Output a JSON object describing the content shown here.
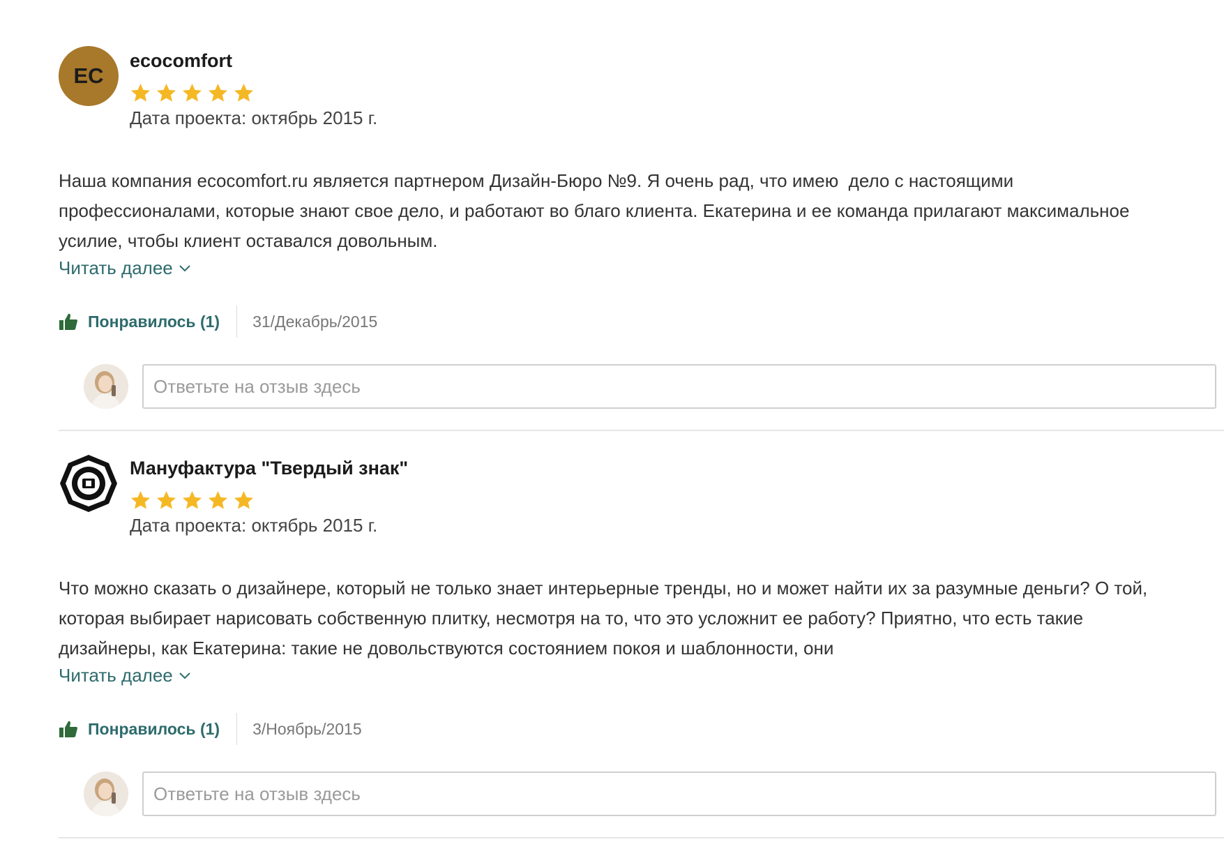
{
  "reviews": [
    {
      "reviewer_name": "ecocomfort",
      "avatar_initials": "EC",
      "rating": 5,
      "project_date": "Дата проекта: октябрь 2015 г.",
      "text": "Наша компания ecocomfort.ru является партнером Дизайн-Бюро №9. Я очень рад, что имею  дело с настоящими профессионалами, которые знают свое дело, и работают во благо клиента. Екатерина и ее команда прилагают максимальное усилие, чтобы клиент оставался довольным.",
      "read_more": "Читать далее",
      "like_label": "Понравилось (1)",
      "date": "31/Декабрь/2015",
      "reply_placeholder": "Ответьте на отзыв здесь"
    },
    {
      "reviewer_name": "Мануфактура \"Твердый знак\"",
      "avatar_logo": "manufaktura-logo",
      "rating": 5,
      "project_date": "Дата проекта: октябрь 2015 г.",
      "text": "Что можно сказать о дизайнере, который не только знает интерьерные тренды, но и может найти их за разумные деньги? О той, которая выбирает нарисовать собственную плитку, несмотря на то, что это усложнит ее работу? Приятно, что есть такие дизайнеры, как Екатерина: такие не довольствуются состоянием покоя и шаблонности, они",
      "read_more": "Читать далее",
      "like_label": "Понравилось (1)",
      "date": "3/Ноябрь/2015",
      "reply_placeholder": "Ответьте на отзыв здесь"
    }
  ],
  "colors": {
    "star": "#f5b825",
    "accent_link": "#2e6b6c",
    "like_icon": "#2f6a3a",
    "avatar_bg": "#a8782b"
  },
  "icons": [
    "star-icon",
    "thumbs-up-icon",
    "chevron-down-icon",
    "user-avatar"
  ]
}
